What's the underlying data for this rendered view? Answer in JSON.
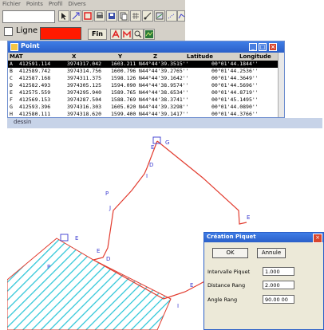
{
  "menubar": {
    "items": [
      "Fichier",
      "Points",
      "Profil",
      "Divers"
    ]
  },
  "toolbar": {
    "ligne_label": "Ligne",
    "fin_label": "Fin",
    "line_color": "#ff1a00"
  },
  "point_window": {
    "title": "Point",
    "columns": [
      "MAT",
      "X",
      "Y",
      "Z",
      "Latitude",
      "Longitude"
    ],
    "rows": [
      {
        "mat": "A",
        "x": "412591.114",
        "y": "3974317.042",
        "z": "1603.211",
        "lat": "N44°44'39.3515''",
        "lon": "00°01'44.1844''",
        "selected": true
      },
      {
        "mat": "B",
        "x": "412589.742",
        "y": "3974314.756",
        "z": "1600.796",
        "lat": "N44°44'39.2765''",
        "lon": "00°01'44.2536''",
        "selected": false
      },
      {
        "mat": "C",
        "x": "412587.168",
        "y": "3974311.375",
        "z": "1598.126",
        "lat": "N44°44'39.1642''",
        "lon": "00°01'44.3649''",
        "selected": false
      },
      {
        "mat": "D",
        "x": "412582.493",
        "y": "3974305.125",
        "z": "1594.090",
        "lat": "N44°44'38.9574''",
        "lon": "00°01'44.5696''",
        "selected": false
      },
      {
        "mat": "E",
        "x": "412575.559",
        "y": "3974295.940",
        "z": "1589.765",
        "lat": "N44°44'38.6534''",
        "lon": "00°01'44.8719''",
        "selected": false
      },
      {
        "mat": "F",
        "x": "412569.153",
        "y": "3974287.504",
        "z": "1588.769",
        "lat": "N44°44'38.3741''",
        "lon": "00°01'45.1495''",
        "selected": false
      },
      {
        "mat": "G",
        "x": "412593.396",
        "y": "3974316.303",
        "z": "1605.020",
        "lat": "N44°44'39.3298''",
        "lon": "00°01'44.0890''",
        "selected": false
      },
      {
        "mat": "H",
        "x": "412580.111",
        "y": "3974318.620",
        "z": "1599.400",
        "lat": "N44°44'39.1417''",
        "lon": "00°01'44.3766''",
        "selected": false
      }
    ]
  },
  "dessin_window": {
    "title": "dessin"
  },
  "piquet_dialog": {
    "title": "Création Piquet",
    "ok_label": "OK",
    "cancel_label": "Annule",
    "fields": [
      {
        "label": "Intervalle Piquet",
        "value": "1.000"
      },
      {
        "label": "Distance Rang",
        "value": "2.000"
      },
      {
        "label": "Angle Rang",
        "value": "90.00 00"
      }
    ]
  },
  "colors": {
    "xp_blue": "#2a5fc8",
    "polyline_red": "#e23b2e",
    "hatch_cyan": "#2cc6d8",
    "marker_blue": "#3a3ad0"
  }
}
